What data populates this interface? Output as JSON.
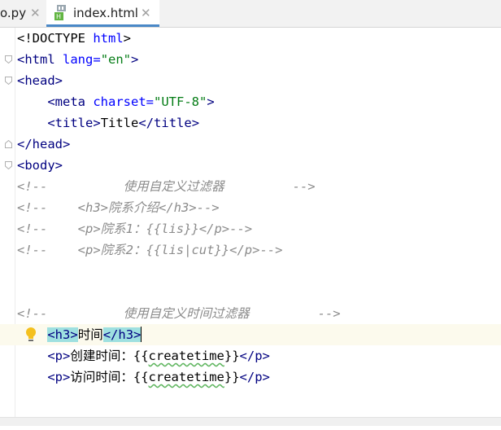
{
  "tabs": [
    {
      "label": "o.py",
      "close": "✕"
    },
    {
      "label": "index.html",
      "close": "✕"
    }
  ],
  "lines": [
    [
      "<!DOCTYPE ",
      "html",
      ">"
    ],
    [
      "<",
      "html",
      " ",
      "lang",
      "=",
      "\"en\"",
      ">"
    ],
    [
      "<",
      "head",
      ">"
    ],
    [
      "    <",
      "meta",
      " ",
      "charset",
      "=",
      "\"UTF-8\"",
      ">"
    ],
    [
      "    <",
      "title",
      ">",
      "Title",
      "</",
      "title",
      ">"
    ],
    [
      "</",
      "head",
      ">"
    ],
    [
      "<",
      "body",
      ">"
    ],
    [
      "<!--",
      "          使用自定义过滤器         -->"
    ],
    [
      "<!--",
      "    <h3>院系介绍</h3>-->"
    ],
    [
      "<!--",
      "    <p>院系1：{{lis}}</p>-->"
    ],
    [
      "<!--",
      "    <p>院系2：{{lis|cut}}</p>-->"
    ],
    [
      "<!--",
      "          使用自定义时间过滤器         -->"
    ],
    [
      "    ",
      "<",
      "h3",
      ">",
      "时间",
      "</",
      "h3",
      ">"
    ],
    [
      "    <",
      "p",
      ">",
      "创建时间：{{",
      "createtime",
      "}}",
      "</",
      "p",
      ">"
    ],
    [
      "    <",
      "p",
      ">",
      "访问时间：{{",
      "createtime",
      "}}",
      "</",
      "p",
      ">"
    ]
  ]
}
